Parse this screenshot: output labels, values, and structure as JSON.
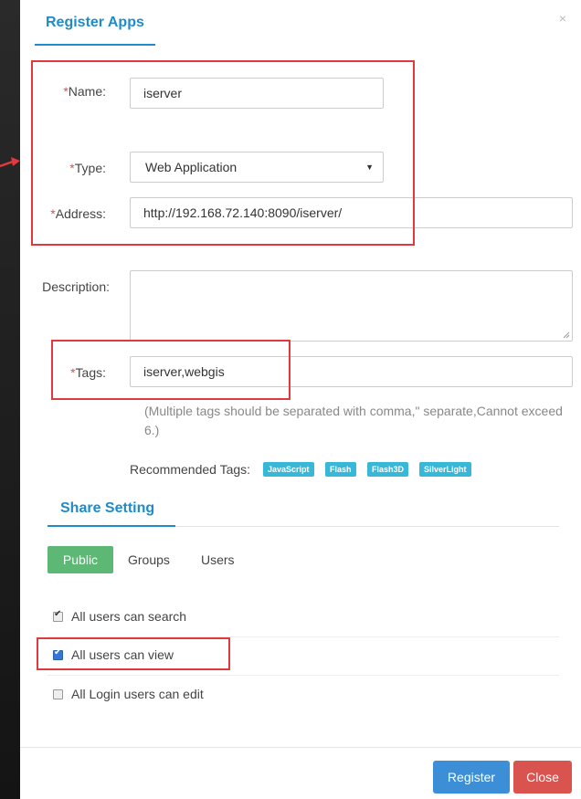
{
  "dialog": {
    "title": "Register Apps",
    "close_glyph": "×"
  },
  "form": {
    "required_mark": "*",
    "name": {
      "label": "Name:",
      "value": "iserver"
    },
    "type": {
      "label": "Type:",
      "selected": "Web Application",
      "caret": "▼"
    },
    "address": {
      "label": "Address:",
      "value": "http://192.168.72.140:8090/iserver/"
    },
    "description": {
      "label": "Description:",
      "value": ""
    },
    "tags": {
      "label": "Tags:",
      "value": "iserver,webgis",
      "hint": "(Multiple tags should be separated with comma,\"   separate,Cannot exceed 6.)"
    },
    "recommended": {
      "label": "Recommended Tags:",
      "tags": [
        "JavaScript",
        "Flash",
        "Flash3D",
        "SilverLight"
      ],
      "color": "#37b8d9"
    }
  },
  "share": {
    "title": "Share Setting",
    "tabs": [
      "Public",
      "Groups",
      "Users"
    ],
    "active_tab": "Public",
    "active_color": "#5cb874",
    "options": [
      {
        "label": "All users can search",
        "checked": true
      },
      {
        "label": "All users can view",
        "checked": true
      },
      {
        "label": "All Login users can edit",
        "checked": false
      }
    ]
  },
  "footer": {
    "register_label": "Register",
    "close_label": "Close",
    "register_color": "#3c8fd6",
    "close_color": "#d9534f"
  },
  "annotation_color": "#e0393e",
  "accent": "#1f8bc9"
}
